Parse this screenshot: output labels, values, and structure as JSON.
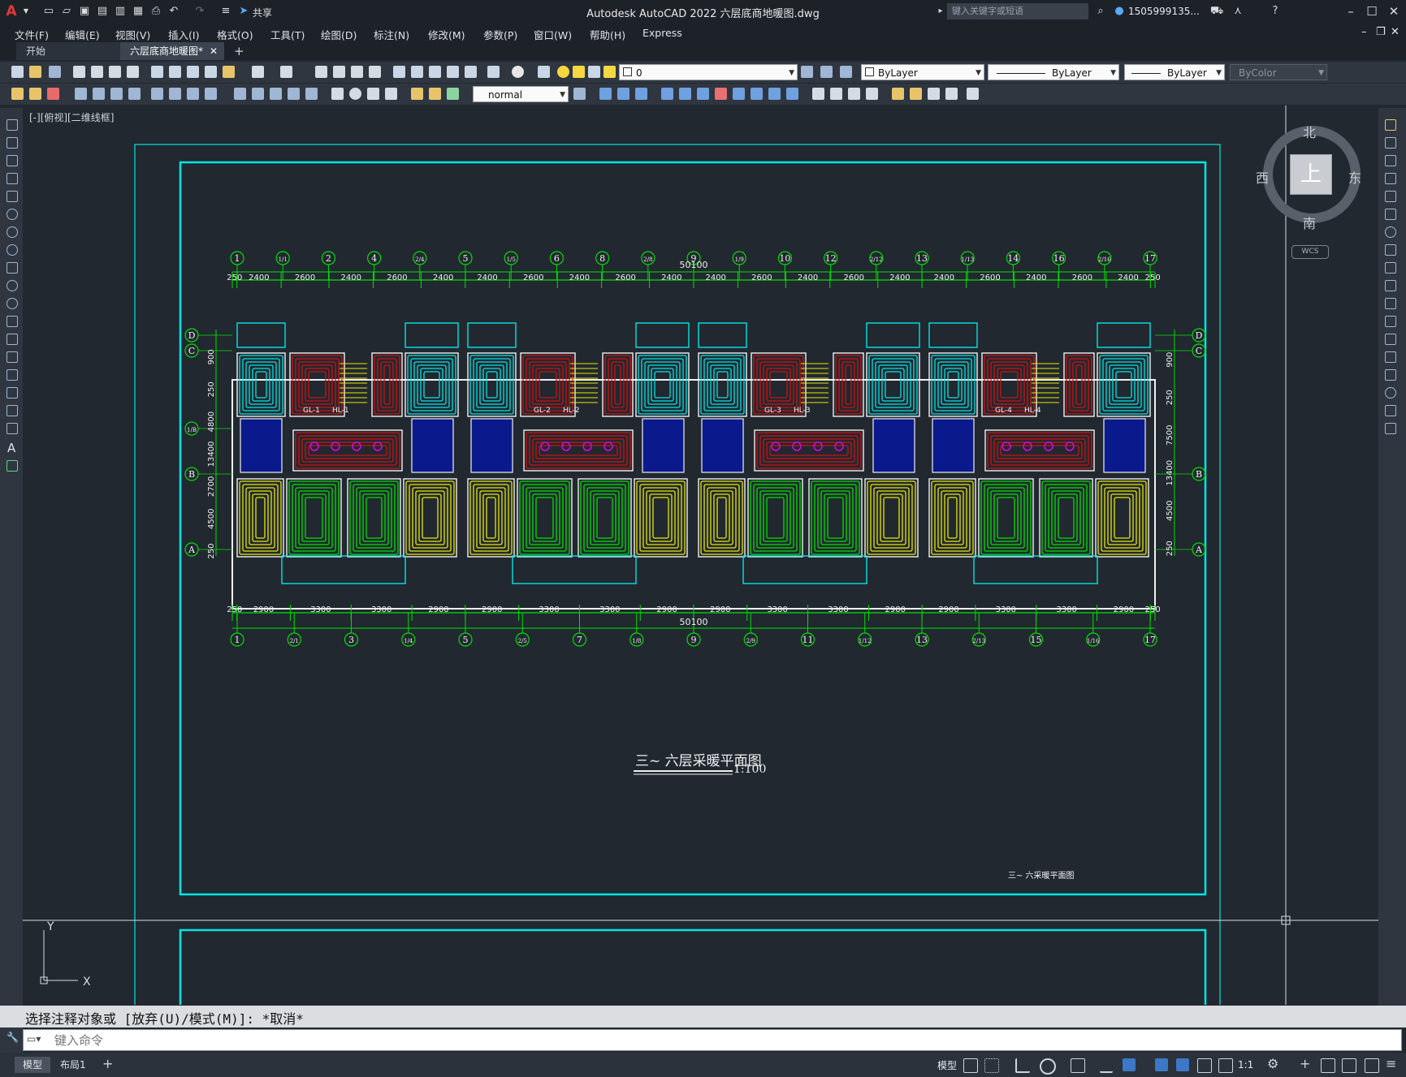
{
  "app": {
    "title": "Autodesk AutoCAD 2022    六层底商地暖图.dwg",
    "share_label": "共享",
    "search_placeholder": "键入关键字或短语",
    "user_label": "1505999135...",
    "logo_letter": "A"
  },
  "menu": [
    "文件(F)",
    "编辑(E)",
    "视图(V)",
    "插入(I)",
    "格式(O)",
    "工具(T)",
    "绘图(D)",
    "标注(N)",
    "修改(M)",
    "参数(P)",
    "窗口(W)",
    "帮助(H)",
    "Express"
  ],
  "tabs": [
    {
      "label": "开始",
      "active": false
    },
    {
      "label": "六层底商地暖图*",
      "active": true
    }
  ],
  "toolbar": {
    "layer_value": "0",
    "color_value": "ByLayer",
    "linetype_value": "ByLayer",
    "lineweight_value": "ByLayer",
    "plotstyle_value": "ByColor",
    "dimstyle_value": "normal"
  },
  "viewport": {
    "label": "[-][俯视][二维线框]"
  },
  "viewcube": {
    "north": "北",
    "south": "南",
    "east": "东",
    "west": "西",
    "face": "上",
    "wcs": "WCS"
  },
  "ucs": {
    "x": "X",
    "y": "Y"
  },
  "drawing": {
    "title": "三~ 六层采暖平面图",
    "scale": "1:100",
    "small_title": "三~ 六采暖平面图",
    "top_dims": [
      "250",
      "2400",
      "2600",
      "2400",
      "2600",
      "2400",
      "2400",
      "2600",
      "2400",
      "2600",
      "2400",
      "2400",
      "2600",
      "2400",
      "2600",
      "2400",
      "2400",
      "2600",
      "2400",
      "2600",
      "2400",
      "250"
    ],
    "top_total": "50100",
    "top_axes": [
      "1",
      "1/1",
      "2",
      "4",
      "2/4",
      "5",
      "1/5",
      "6",
      "8",
      "2/8",
      "9",
      "1/9",
      "10",
      "12",
      "2/12",
      "13",
      "1/13",
      "14",
      "16",
      "2/16",
      "17"
    ],
    "bottom_dims": [
      "250",
      "2900",
      "3300",
      "3300",
      "2900",
      "2900",
      "3300",
      "3300",
      "2900",
      "2900",
      "3300",
      "3300",
      "2900",
      "2900",
      "3300",
      "3300",
      "2900",
      "250"
    ],
    "bottom_total": "50100",
    "bottom_axes": [
      "1",
      "2/1",
      "3",
      "1/4",
      "5",
      "2/5",
      "7",
      "1/8",
      "9",
      "2/9",
      "11",
      "1/12",
      "13",
      "2/13",
      "15",
      "1/16",
      "17"
    ],
    "row_axes": [
      "D",
      "C",
      "1/B",
      "B",
      "A"
    ],
    "left_dims": [
      "900",
      "250",
      "4800",
      "13400",
      "2700",
      "4500",
      "250"
    ],
    "right_dims": [
      "900",
      "250",
      "7500",
      "13400",
      "4500",
      "250"
    ],
    "riser_labels": [
      "GL-1",
      "HL-1",
      "GL-2",
      "HL-2",
      "GL-3",
      "HL-3",
      "GL-4",
      "HL-4"
    ]
  },
  "command": {
    "history": "选择注释对象或 [放弃(U)/模式(M)]: *取消*",
    "placeholder": "键入命令"
  },
  "status": {
    "layout_tabs": [
      "模型",
      "布局1"
    ],
    "model_label": "模型",
    "scale_label": "1:1"
  },
  "colors": {
    "background": "#212830",
    "cyan": "#00e5e5",
    "green": "#00e000",
    "red": "#d01010",
    "blue": "#0a1a8c",
    "yellow": "#e8e800",
    "magenta": "#e000e0",
    "white": "#f0f0f0"
  }
}
